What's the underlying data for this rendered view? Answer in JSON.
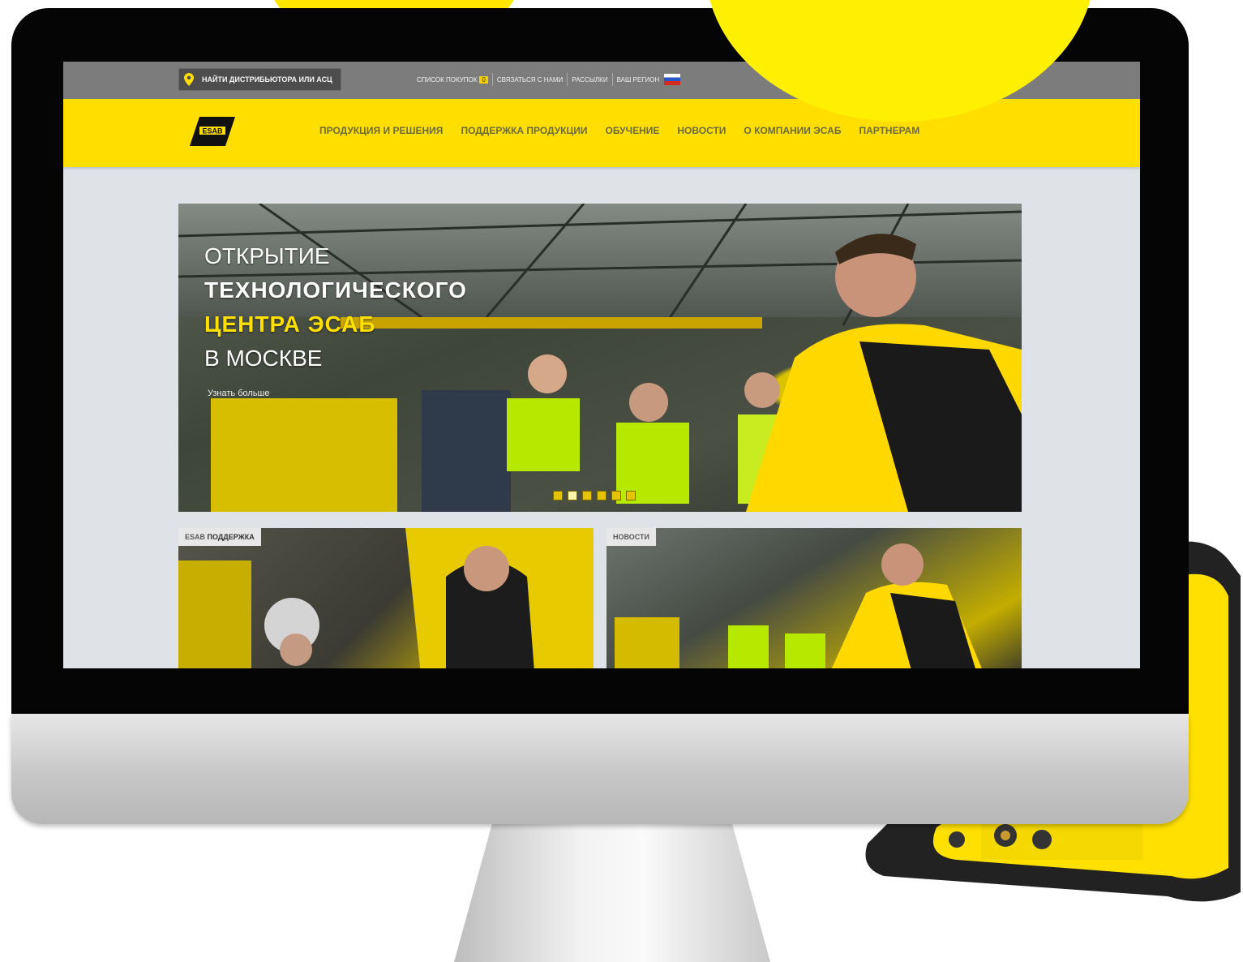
{
  "topbar": {
    "find_label": "НАЙТИ ДИСТРИБЬЮТОРА ИЛИ АСЦ",
    "links": [
      "СПИСОК ПОКУПОК",
      "СВЯЗАТЬСЯ С НАМИ",
      "РАССЫЛКИ",
      "ВАШ РЕГИОН"
    ],
    "cart_count": "0"
  },
  "header": {
    "logo_text": "ESAB",
    "nav": [
      "ПРОДУКЦИЯ И РЕШЕНИЯ",
      "ПОДДЕРЖКА ПРОДУКЦИИ",
      "ОБУЧЕНИЕ",
      "НОВОСТИ",
      "О КОМПАНИИ ЭСАБ",
      "ПАРТНЕРАМ"
    ]
  },
  "hero": {
    "line1": "ОТКРЫТИЕ",
    "line2": "ТЕХНОЛОГИЧЕСКОГО",
    "line3": "ЦЕНТРА ЭСАБ",
    "line4": "В МОСКВЕ",
    "more": "Узнать больше",
    "slides_total": 6,
    "active_slide": 2
  },
  "cards": {
    "left_prefix": "ESAB",
    "left_title": "ПОДДЕРЖКА",
    "right_title": "НОВОСТИ"
  },
  "colors": {
    "brand_yellow": "#ffde00",
    "topbar_gray": "#7c7c7c",
    "bezel": "#050505"
  },
  "icons": [
    "map-pin-icon",
    "russia-flag-icon",
    "esab-logo-icon"
  ]
}
